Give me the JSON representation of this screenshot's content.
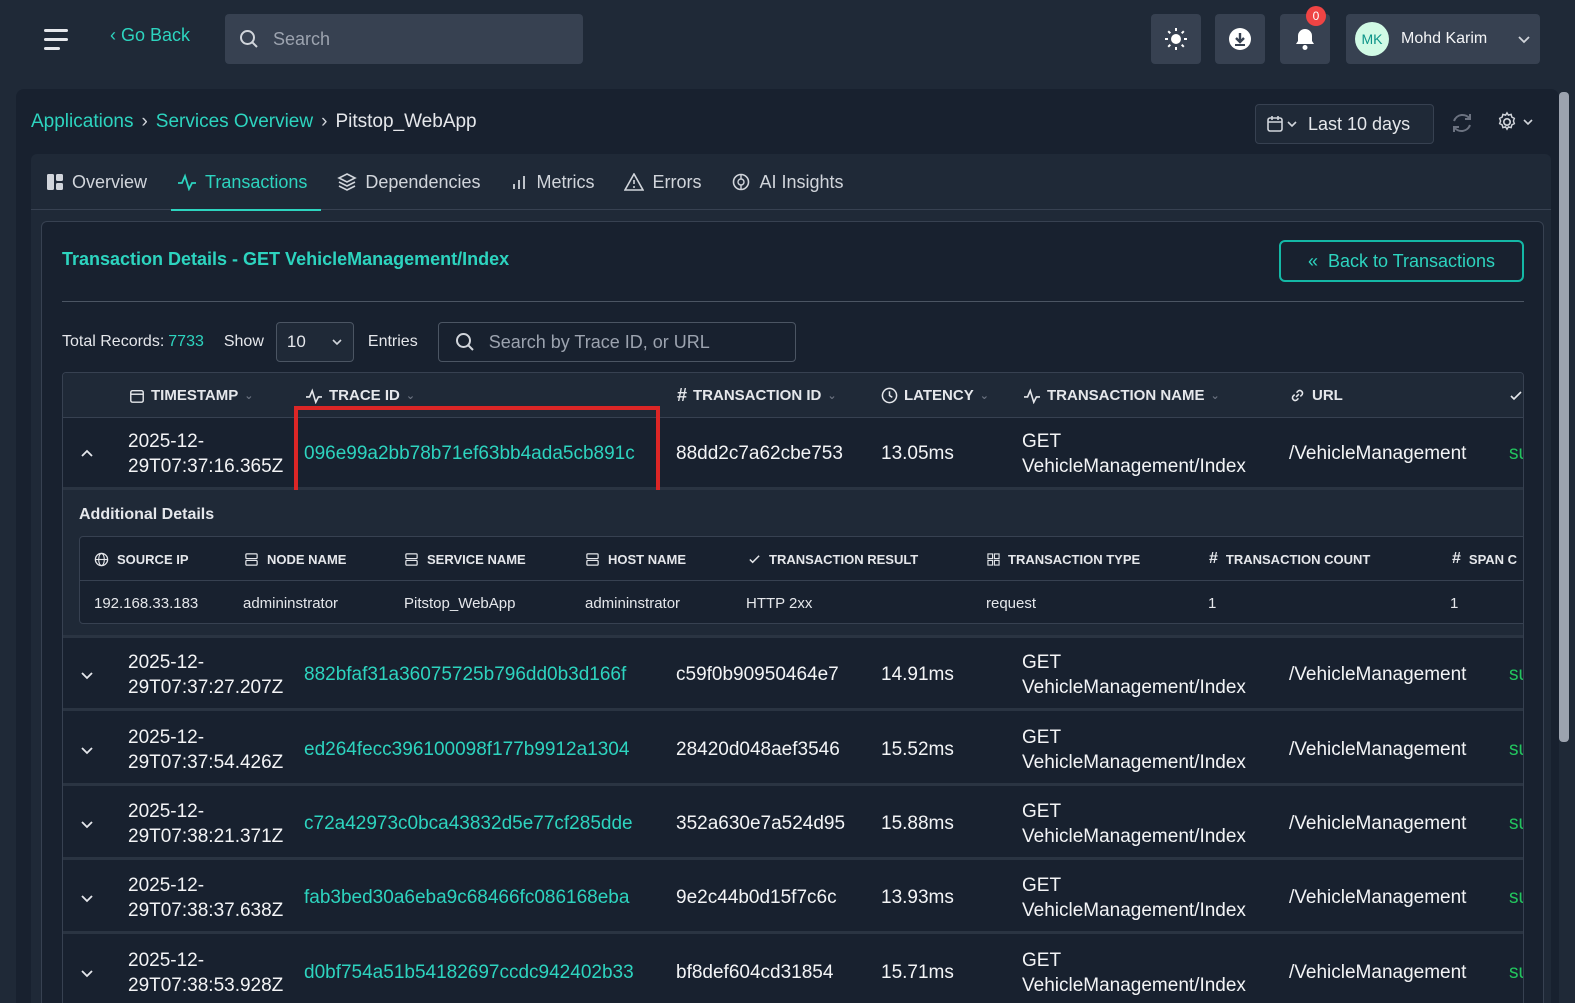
{
  "topbar": {
    "go_back": "‹ Go Back",
    "search_placeholder": "Search",
    "notification_count": "0",
    "user_initials": "MK",
    "user_name": "Mohd Karim"
  },
  "breadcrumb": {
    "items": [
      "Applications",
      "Services Overview",
      "Pitstop_WebApp"
    ]
  },
  "date_range": "Last 10 days",
  "tabs": [
    {
      "label": "Overview"
    },
    {
      "label": "Transactions"
    },
    {
      "label": "Dependencies"
    },
    {
      "label": "Metrics"
    },
    {
      "label": "Errors"
    },
    {
      "label": "AI Insights"
    }
  ],
  "card": {
    "title": "Transaction Details - GET VehicleManagement/Index",
    "back_button": "Back to Transactions"
  },
  "controls": {
    "total_label": "Total Records:",
    "total_value": "7733",
    "show_label": "Show",
    "show_value": "10",
    "entries_label": "Entries",
    "search_placeholder": "Search by Trace ID, or URL"
  },
  "table": {
    "headers": [
      "TIMESTAMP",
      "TRACE ID",
      "TRANSACTION ID",
      "LATENCY",
      "TRANSACTION NAME",
      "URL"
    ],
    "rows": [
      {
        "ts1": "2025-12-",
        "ts2": "29T07:37:16.365Z",
        "trace": "096e99a2bb78b71ef63bb4ada5cb891c",
        "txid": "88dd2c7a62cbe753",
        "latency": "13.05ms",
        "name1": "GET",
        "name2": "VehicleManagement/Index",
        "url": "/VehicleManagement",
        "status": "su"
      },
      {
        "ts1": "2025-12-",
        "ts2": "29T07:37:27.207Z",
        "trace": "882bfaf31a36075725b796dd0b3d166f",
        "txid": "c59f0b90950464e7",
        "latency": "14.91ms",
        "name1": "GET",
        "name2": "VehicleManagement/Index",
        "url": "/VehicleManagement",
        "status": "su"
      },
      {
        "ts1": "2025-12-",
        "ts2": "29T07:37:54.426Z",
        "trace": "ed264fecc396100098f177b9912a1304",
        "txid": "28420d048aef3546",
        "latency": "15.52ms",
        "name1": "GET",
        "name2": "VehicleManagement/Index",
        "url": "/VehicleManagement",
        "status": "su"
      },
      {
        "ts1": "2025-12-",
        "ts2": "29T07:38:21.371Z",
        "trace": "c72a42973c0bca43832d5e77cf285dde",
        "txid": "352a630e7a524d95",
        "latency": "15.88ms",
        "name1": "GET",
        "name2": "VehicleManagement/Index",
        "url": "/VehicleManagement",
        "status": "su"
      },
      {
        "ts1": "2025-12-",
        "ts2": "29T07:38:37.638Z",
        "trace": "fab3bed30a6eba9c68466fc086168eba",
        "txid": "9e2c44b0d15f7c6c",
        "latency": "13.93ms",
        "name1": "GET",
        "name2": "VehicleManagement/Index",
        "url": "/VehicleManagement",
        "status": "su"
      },
      {
        "ts1": "2025-12-",
        "ts2": "29T07:38:53.928Z",
        "trace": "d0bf754a51b54182697ccdc942402b33",
        "txid": "bf8def604cd31854",
        "latency": "15.71ms",
        "name1": "GET",
        "name2": "VehicleManagement/Index",
        "url": "/VehicleManagement",
        "status": "su"
      }
    ]
  },
  "details": {
    "title": "Additional Details",
    "headers": [
      "SOURCE IP",
      "NODE NAME",
      "SERVICE NAME",
      "HOST NAME",
      "TRANSACTION RESULT",
      "TRANSACTION TYPE",
      "TRANSACTION COUNT",
      "SPAN C"
    ],
    "values": [
      "192.168.33.183",
      "admininstrator",
      "Pitstop_WebApp",
      "admininstrator",
      "HTTP 2xx",
      "request",
      "1",
      "1"
    ]
  },
  "colors": {
    "accent": "#2dd4bf",
    "highlight": "#dc2626",
    "success": "#22c55e"
  }
}
